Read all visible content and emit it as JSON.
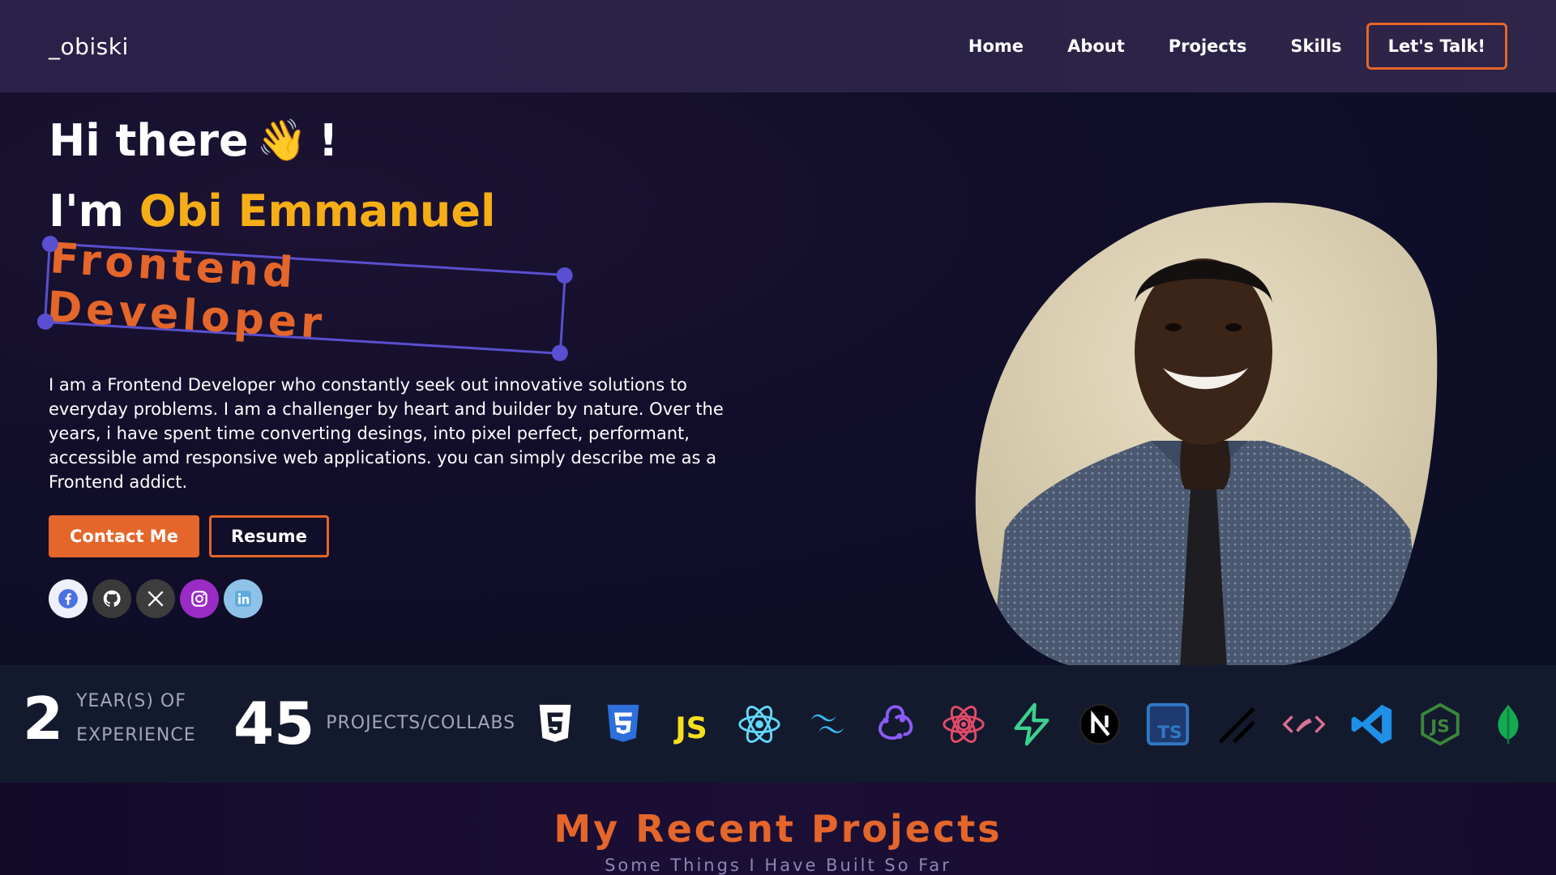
{
  "nav": {
    "logo": "_obiski",
    "links": [
      "Home",
      "About",
      "Projects",
      "Skills"
    ],
    "cta": "Let's Talk!"
  },
  "hero": {
    "greeting": "Hi there",
    "greeting_emoji": "👋",
    "greeting_end": "!",
    "intro_prefix": "I'm",
    "name": "Obi Emmanuel",
    "role": "Frontend Developer",
    "bio": "I am a Frontend Developer who constantly seek out innovative solutions to everyday problems. I am a challenger by heart and builder by nature. Over the years, i have spent time converting desings, into pixel perfect, performant, accessible amd responsive web applications. you can simply describe me as a Frontend addict.",
    "contact_button": "Contact Me",
    "resume_button": "Resume",
    "socials": [
      "facebook-icon",
      "github-icon",
      "x-icon",
      "instagram-icon",
      "linkedin-icon"
    ]
  },
  "stats": {
    "years_value": "2",
    "years_label_1": "YEAR(S) OF",
    "years_label_2": "EXPERIENCE",
    "projects_value": "45",
    "projects_label": "PROJECTS/COLLABS"
  },
  "tech_stack": [
    "html5-icon",
    "css3-icon",
    "javascript-icon",
    "react-icon",
    "tailwind-icon",
    "redux-icon",
    "react-native-icon",
    "supabase-icon",
    "nextjs-icon",
    "typescript-icon",
    "shadcn-icon",
    "styled-components-icon",
    "vscode-icon",
    "nodejs-icon",
    "mongodb-icon"
  ],
  "tech_text": {
    "js": "JS",
    "ts": "TS"
  },
  "projects": {
    "title": "My Recent Projects",
    "subtitle": "Some Things I Have Built So Far"
  },
  "colors": {
    "accent": "#e4662a",
    "name": "#f6ae16",
    "handle": "#5a4fd0"
  }
}
